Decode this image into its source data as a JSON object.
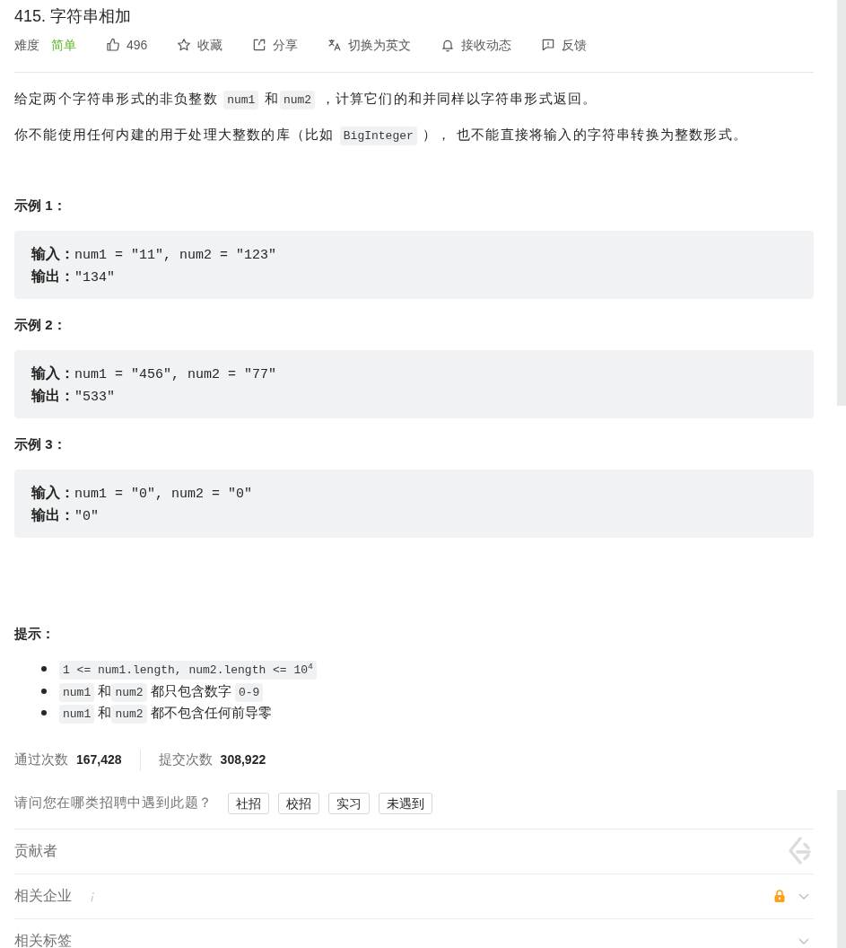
{
  "problem": {
    "title": "415. 字符串相加"
  },
  "meta": {
    "difficulty": {
      "label": "难度",
      "value": "简单"
    },
    "actions": [
      {
        "kind": "like",
        "label": "496"
      },
      {
        "kind": "favorite",
        "label": "收藏"
      },
      {
        "kind": "share",
        "label": "分享"
      },
      {
        "kind": "translate",
        "label": "切换为英文"
      },
      {
        "kind": "subscribe",
        "label": "接收动态"
      },
      {
        "kind": "feedback",
        "label": "反馈"
      }
    ]
  },
  "description": [
    [
      {
        "kind": "text",
        "text": "给定两个字符串形式的非负整数 "
      },
      {
        "kind": "code",
        "text": "num1"
      },
      {
        "kind": "text",
        "text": " 和"
      },
      {
        "kind": "code",
        "text": "num2"
      },
      {
        "kind": "text",
        "text": " ，计算它们的和并同样以字符串形式返回。"
      }
    ],
    [
      {
        "kind": "text",
        "text": "你不能使用任何内建的用于处理大整数的库（比如 "
      },
      {
        "kind": "code",
        "text": "BigInteger"
      },
      {
        "kind": "text",
        "text": " ）， 也不能直接将输入的字符串转换为整数形式。"
      }
    ]
  ],
  "examples": [
    {
      "title": "示例 1：",
      "lines": [
        {
          "label": "输入：",
          "value": "num1 = \"11\", num2 = \"123\""
        },
        {
          "label": "输出：",
          "value": "\"134\""
        }
      ]
    },
    {
      "title": "示例 2：",
      "lines": [
        {
          "label": "输入：",
          "value": "num1 = \"456\", num2 = \"77\""
        },
        {
          "label": "输出：",
          "value": "\"533\""
        }
      ]
    },
    {
      "title": "示例 3：",
      "lines": [
        {
          "label": "输入：",
          "value": "num1 = \"0\", num2 = \"0\""
        },
        {
          "label": "输出：",
          "value": "\"0\""
        }
      ]
    }
  ],
  "hints": {
    "title": "提示：",
    "items": [
      [
        {
          "kind": "code",
          "text": "1 <= num1.length, num2.length <= 10$^{4}$"
        }
      ],
      [
        {
          "kind": "code",
          "text": "num1"
        },
        {
          "kind": "text",
          "text": " 和"
        },
        {
          "kind": "code",
          "text": "num2"
        },
        {
          "kind": "text",
          "text": " 都只包含数字 "
        },
        {
          "kind": "code",
          "text": "0-9"
        }
      ],
      [
        {
          "kind": "code",
          "text": "num1"
        },
        {
          "kind": "text",
          "text": " 和"
        },
        {
          "kind": "code",
          "text": "num2"
        },
        {
          "kind": "text",
          "text": " 都不包含任何前导零"
        }
      ]
    ]
  },
  "stats": [
    {
      "label": "通过次数",
      "value": "167,428"
    },
    {
      "label": "提交次数",
      "value": "308,922"
    }
  ],
  "survey": {
    "question": "请问您在哪类招聘中遇到此题？",
    "options": [
      {
        "label": "社招",
        "selected": false
      },
      {
        "label": "校招",
        "selected": false
      },
      {
        "label": "实习",
        "selected": false
      },
      {
        "label": "未遇到",
        "selected": false
      }
    ]
  },
  "sections": [
    {
      "kind": "contributors",
      "title": "贡献者"
    },
    {
      "kind": "collapsible",
      "title": "相关企业",
      "info": true,
      "locked": true,
      "expanded": false
    },
    {
      "kind": "collapsible",
      "title": "相关标签",
      "info": false,
      "locked": false,
      "expanded": false
    }
  ]
}
